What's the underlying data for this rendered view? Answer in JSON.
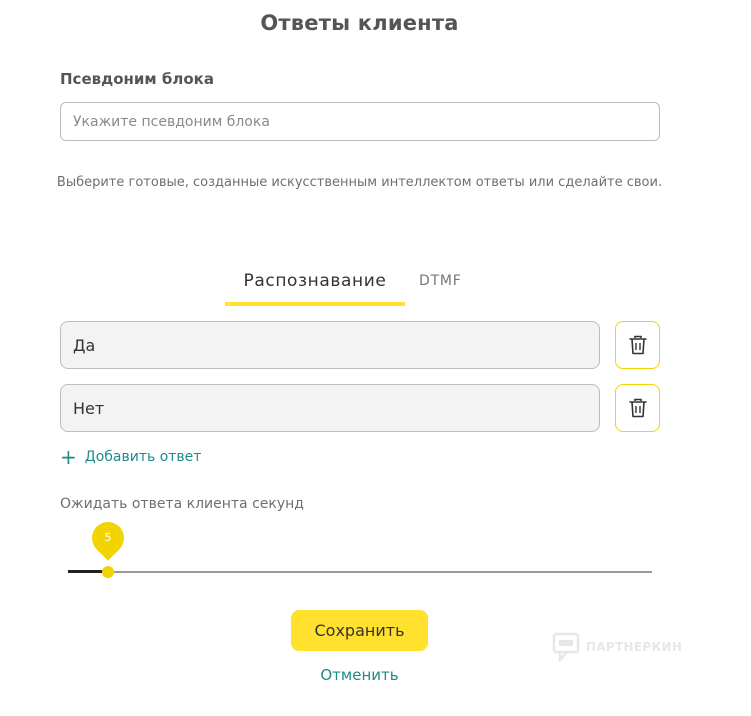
{
  "dialog": {
    "title": "Ответы клиента"
  },
  "alias": {
    "label": "Псевдоним блока",
    "value": "",
    "placeholder": "Укажите псевдоним блока"
  },
  "hint": "Выберите готовые, созданные искусственным интеллектом ответы или сделайте свои.",
  "tabs": [
    {
      "label": "Распознавание",
      "active": true
    },
    {
      "label": "DTMF",
      "active": false
    }
  ],
  "answers": [
    {
      "value": "Да",
      "delete_icon": "trash-icon"
    },
    {
      "value": "Нет",
      "delete_icon": "trash-icon"
    }
  ],
  "add_answer": {
    "icon": "plus-icon",
    "label": "Добавить ответ"
  },
  "wait": {
    "label": "Ожидать ответа клиента секунд",
    "value": "5",
    "fraction": 0.068
  },
  "actions": {
    "save_label": "Сохранить",
    "cancel_label": "Отменить"
  },
  "watermark": {
    "text": "ПАРТНЕРКИН"
  },
  "colors": {
    "accent": "#ffe12e",
    "link": "#1f8a8a",
    "thumb": "#f2d400"
  }
}
